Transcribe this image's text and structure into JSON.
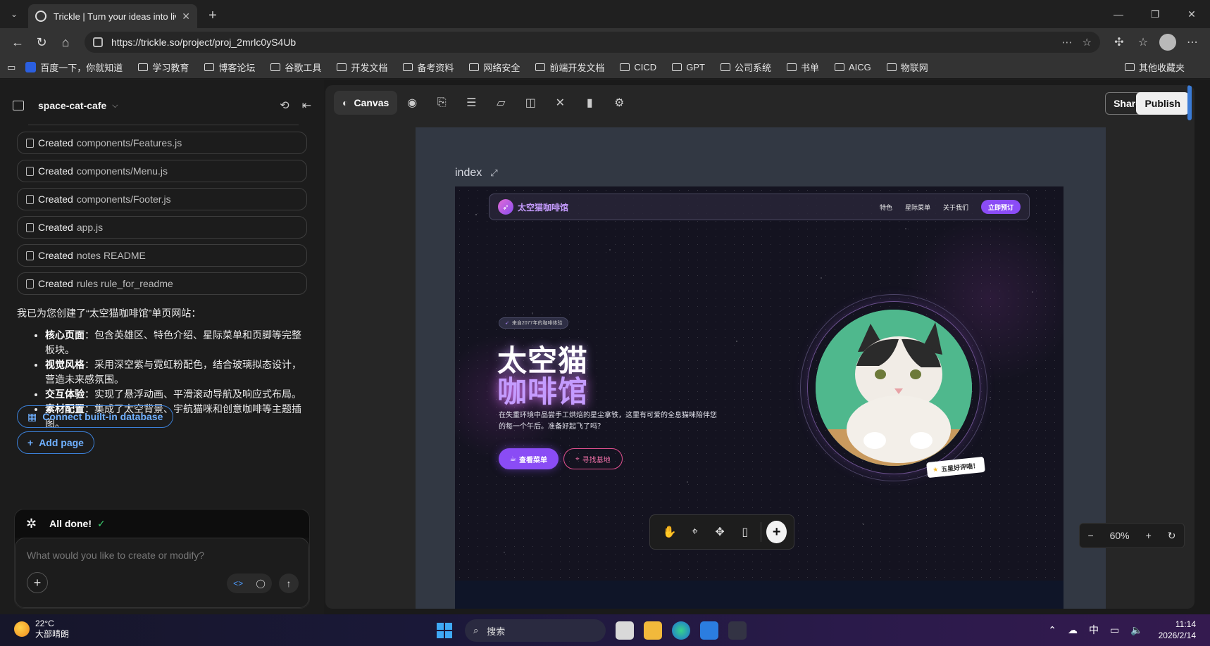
{
  "browser": {
    "tab_title": "Trickle | Turn your ideas into live apps",
    "url": "https://trickle.so/project/proj_2mrlc0yS4Ub",
    "bookmarks": [
      "百度一下，你就知道",
      "学习教育",
      "博客论坛",
      "谷歌工具",
      "开发文档",
      "备考资料",
      "网络安全",
      "前端开发文档",
      "CICD",
      "GPT",
      "公司系统",
      "书单",
      "AICG",
      "物联网"
    ],
    "other_bookmarks": "其他收藏夹"
  },
  "sidebar": {
    "project_name": "space-cat-cafe",
    "created_items": [
      {
        "label": "Created",
        "path": "components/Features.js"
      },
      {
        "label": "Created",
        "path": "components/Menu.js"
      },
      {
        "label": "Created",
        "path": "components/Footer.js"
      },
      {
        "label": "Created",
        "path": "app.js"
      },
      {
        "label": "Created",
        "path": "notes README"
      },
      {
        "label": "Created",
        "path": "rules rule_for_readme"
      }
    ],
    "summary_intro": "我已为您创建了“太空猫咖啡馆”单页网站：",
    "summary_points": [
      {
        "title": "核心页面",
        "text": "：包含英雄区、特色介绍、星际菜单和页脚等完整板块。"
      },
      {
        "title": "视觉风格",
        "text": "：采用深空紫与霓虹粉配色，结合玻璃拟态设计，营造未来感氛围。"
      },
      {
        "title": "交互体验",
        "text": "：实现了悬浮动画、平滑滚动导航及响应式布局。"
      },
      {
        "title": "素材配置",
        "text": "：集成了太空背景、宇航猫咪和创意咖啡等主题插图。"
      }
    ],
    "connect_db_label": "Connect built-in database",
    "add_page_label": "Add page",
    "status": "All done!",
    "input_placeholder": "What would you like to create or modify?"
  },
  "canvas": {
    "active_tab": "Canvas",
    "share_label": "Share",
    "publish_label": "Publish",
    "page_name": "index",
    "zoom_level": "60%"
  },
  "preview": {
    "brand": "太空猫咖啡馆",
    "nav_links": [
      "特色",
      "星际菜单",
      "关于我们"
    ],
    "nav_cta": "立即预订",
    "badge": "来自2077年的咖啡体验",
    "headline_1": "太空猫",
    "headline_2": "咖啡馆",
    "description": "在失重环境中品尝手工烘焙的星尘拿铁，这里有可爱的全息猫咪陪伴您的每一个午后。准备好起飞了吗？",
    "btn_primary": "查看菜单",
    "btn_secondary": "寻找基地",
    "sticker": "五星好评喵！"
  },
  "taskbar": {
    "temperature": "22°C",
    "weather": "大部晴朗",
    "search_label": "搜索",
    "ime": "中",
    "time": "11:14",
    "date": "2026/2/14"
  }
}
